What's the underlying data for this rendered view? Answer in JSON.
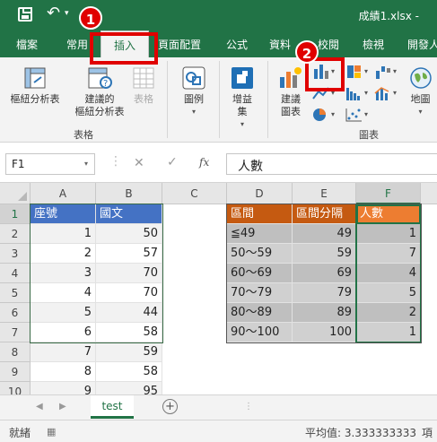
{
  "titlebar": {
    "filename": "成績1.xlsx -"
  },
  "tabs": [
    {
      "label": "檔案"
    },
    {
      "label": "常用"
    },
    {
      "label": "插入"
    },
    {
      "label": "頁面配置"
    },
    {
      "label": "公式"
    },
    {
      "label": "資料"
    },
    {
      "label": "校閱"
    },
    {
      "label": "檢視"
    },
    {
      "label": "開發人"
    }
  ],
  "ribbon": {
    "pivot": "樞紐分析表",
    "recommended_pivot_1": "建議的",
    "recommended_pivot_2": "樞紐分析表",
    "table": "表格",
    "group_tables": "表格",
    "illustrations": "圖例",
    "addins_1": "增益",
    "addins_2": "集",
    "rec_charts_1": "建議",
    "rec_charts_2": "圖表",
    "maps": "地圖",
    "group_charts": "圖表"
  },
  "formula_bar": {
    "name_box": "F1",
    "fx": "fx",
    "value": "人數"
  },
  "columns": [
    "A",
    "B",
    "C",
    "D",
    "E",
    "F"
  ],
  "rows": [
    "1",
    "2",
    "3",
    "4",
    "5",
    "6",
    "7",
    "8",
    "9",
    "10"
  ],
  "cells": {
    "A": [
      "座號",
      "1",
      "2",
      "3",
      "4",
      "5",
      "6",
      "7",
      "8",
      "9"
    ],
    "B": [
      "國文",
      "50",
      "57",
      "70",
      "70",
      "44",
      "58",
      "59",
      "58",
      "95"
    ],
    "D": [
      "區間",
      "≦49",
      "50～59",
      "60～69",
      "70～79",
      "80～89",
      "90～100"
    ],
    "E": [
      "區間分隔",
      "49",
      "59",
      "69",
      "79",
      "89",
      "100"
    ],
    "F": [
      "人數",
      "1",
      "7",
      "4",
      "5",
      "2",
      "1"
    ]
  },
  "sheets": [
    {
      "label": "test"
    }
  ],
  "status": {
    "ready": "就緒",
    "average": "平均值: 3.333333333",
    "more": "項目"
  },
  "callouts": {
    "one": "1",
    "two": "2"
  },
  "colors": {
    "excel_green": "#217346",
    "header_blue": "#4472c4",
    "header_orange": "#c55a11",
    "callout_red": "#e00000"
  }
}
